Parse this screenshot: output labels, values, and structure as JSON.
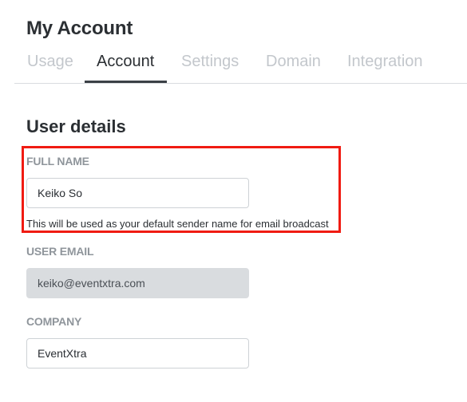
{
  "page": {
    "title": "My Account"
  },
  "tabs": [
    {
      "label": "Usage"
    },
    {
      "label": "Account",
      "active": true
    },
    {
      "label": "Settings"
    },
    {
      "label": "Domain"
    },
    {
      "label": "Integration"
    }
  ],
  "section": {
    "title": "User details"
  },
  "fields": {
    "full_name": {
      "label": "FULL NAME",
      "value": "Keiko So",
      "help": "This will be used as your default sender name for email broadcast"
    },
    "user_email": {
      "label": "USER EMAIL",
      "value": "keiko@eventxtra.com",
      "disabled": true
    },
    "company": {
      "label": "COMPANY",
      "value": "EventXtra"
    }
  },
  "colors": {
    "highlight_border": "#f01b12",
    "active_tab": "#2b2f33",
    "inactive_tab": "#c3c7cc",
    "label": "#8f959b",
    "disabled_input_bg": "#d9dcdf"
  }
}
